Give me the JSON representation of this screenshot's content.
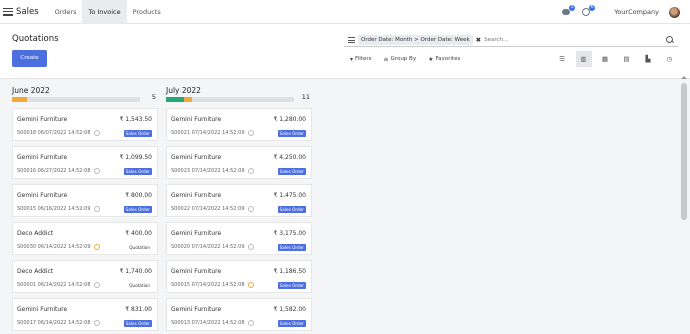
{
  "navbar": {
    "app_title": "Sales",
    "menu_items": [
      "Orders",
      "To Invoice",
      "Products"
    ],
    "active_menu": "To Invoice",
    "messages_badge": "5",
    "activities_badge": "6",
    "company": "YourCompany"
  },
  "control": {
    "title": "Quotations",
    "create_label": "Create",
    "search_facet": "Order Date: Month > Order Date: Week",
    "search_placeholder": "Search...",
    "filters_label": "Filters",
    "groupby_label": "Group By",
    "favorites_label": "Favorites",
    "views": [
      {
        "icon": "list-view-icon",
        "glyph": "☰"
      },
      {
        "icon": "kanban-view-icon",
        "glyph": "▥"
      },
      {
        "icon": "calendar-view-icon",
        "glyph": "▦"
      },
      {
        "icon": "pivot-view-icon",
        "glyph": "▤"
      },
      {
        "icon": "graph-view-icon",
        "glyph": "▙"
      },
      {
        "icon": "activity-view-icon",
        "glyph": "◷"
      }
    ],
    "active_view": "kanban-view-icon"
  },
  "columns": [
    {
      "title": "June 2022",
      "count": "5",
      "progress": [
        {
          "color": "#f0a93b",
          "fraction": 0.12
        }
      ],
      "cards": [
        {
          "partner": "Gemini Furniture",
          "amount": "₹ 1,543.50",
          "ref": "S00018 06/07/2022 14:52:08",
          "activity": "normal",
          "state": "Sales Order",
          "state_kind": "so"
        },
        {
          "partner": "Gemini Furniture",
          "amount": "₹ 1,099.50",
          "ref": "S00016 06/27/2022 14:52:08",
          "activity": "normal",
          "state": "Sales Order",
          "state_kind": "so"
        },
        {
          "partner": "Gemini Furniture",
          "amount": "₹ 800.00",
          "ref": "S00015 06/16/2022 14:52:09",
          "activity": "normal",
          "state": "Sales Order",
          "state_kind": "so"
        },
        {
          "partner": "Deco Addict",
          "amount": "₹ 400.00",
          "ref": "S00030 06/14/2022 14:52:09",
          "activity": "warn",
          "state": "Quotation",
          "state_kind": "qt"
        },
        {
          "partner": "Deco Addict",
          "amount": "₹ 1,740.00",
          "ref": "S00001 06/14/2022 14:52:08",
          "activity": "normal",
          "state": "Quotation",
          "state_kind": "qt"
        },
        {
          "partner": "Gemini Furniture",
          "amount": "₹ 831.00",
          "ref": "S00017 06/14/2022 14:52:08",
          "activity": "normal",
          "state": "Sales Order",
          "state_kind": "so"
        }
      ]
    },
    {
      "title": "July 2022",
      "count": "11",
      "progress": [
        {
          "color": "#28a779",
          "fraction": 0.14
        },
        {
          "color": "#f0a93b",
          "fraction": 0.06
        }
      ],
      "cards": [
        {
          "partner": "Gemini Furniture",
          "amount": "₹ 1,280.00",
          "ref": "S00021 07/14/2022 14:52:09",
          "activity": "normal",
          "state": "Sales Order",
          "state_kind": "so"
        },
        {
          "partner": "Gemini Furniture",
          "amount": "₹ 4,250.00",
          "ref": "S00023 07/14/2022 14:52:09",
          "activity": "normal",
          "state": "Sales Order",
          "state_kind": "so"
        },
        {
          "partner": "Gemini Furniture",
          "amount": "₹ 1,475.00",
          "ref": "S00022 07/14/2022 14:52:09",
          "activity": "normal",
          "state": "Sales Order",
          "state_kind": "so"
        },
        {
          "partner": "Gemini Furniture",
          "amount": "₹ 3,175.00",
          "ref": "S00020 07/14/2022 14:52:09",
          "activity": "normal",
          "state": "Sales Order",
          "state_kind": "so"
        },
        {
          "partner": "Gemini Furniture",
          "amount": "₹ 1,186.50",
          "ref": "S00015 07/14/2022 14:52:08",
          "activity": "warn",
          "state": "Sales Order",
          "state_kind": "so"
        },
        {
          "partner": "Gemini Furniture",
          "amount": "₹ 1,582.00",
          "ref": "S00013 07/14/2022 14:52:08",
          "activity": "normal",
          "state": "Sales Order",
          "state_kind": "so"
        }
      ]
    }
  ]
}
